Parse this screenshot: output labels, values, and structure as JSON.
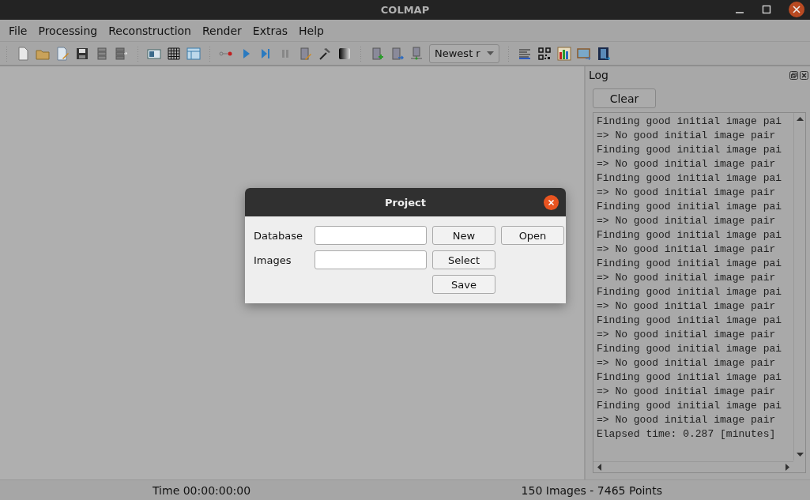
{
  "window": {
    "title": "COLMAP"
  },
  "menu": [
    "File",
    "Processing",
    "Reconstruction",
    "Render",
    "Extras",
    "Help"
  ],
  "toolbar": {
    "combo_value": "Newest r"
  },
  "log": {
    "title": "Log",
    "clear_button": "Clear",
    "lines": [
      "Finding good initial image pai",
      "=> No good initial image pair",
      "Finding good initial image pai",
      "=> No good initial image pair",
      "Finding good initial image pai",
      "=> No good initial image pair",
      "Finding good initial image pai",
      "=> No good initial image pair",
      "Finding good initial image pai",
      "=> No good initial image pair",
      "Finding good initial image pai",
      "=> No good initial image pair",
      "Finding good initial image pai",
      "=> No good initial image pair",
      "Finding good initial image pai",
      "=> No good initial image pair",
      "Finding good initial image pai",
      "=> No good initial image pair",
      "Finding good initial image pai",
      "=> No good initial image pair",
      "Finding good initial image pai",
      "=> No good initial image pair",
      "Elapsed time: 0.287 [minutes]"
    ]
  },
  "dialog": {
    "title": "Project",
    "rows": [
      {
        "label": "Database",
        "buttons": [
          "New",
          "Open"
        ]
      },
      {
        "label": "Images",
        "buttons": [
          "Select"
        ]
      }
    ],
    "save_button": "Save"
  },
  "status_bar": {
    "time": "Time 00:00:00:00",
    "counts": "150 Images - 7465 Points"
  }
}
